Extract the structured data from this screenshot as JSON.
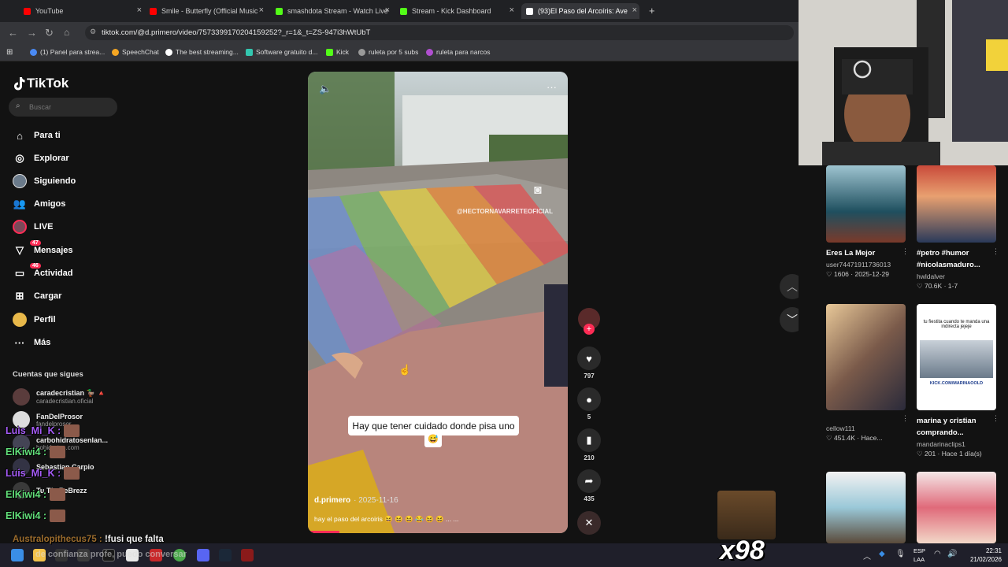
{
  "browser": {
    "tabs": [
      {
        "title": "YouTube",
        "color": "#ff0000"
      },
      {
        "title": "Smile - Butterfly (Official Music",
        "color": "#ff0000"
      },
      {
        "title": "smashdota Stream - Watch Live",
        "color": "#53fc18"
      },
      {
        "title": "Stream - Kick Dashboard",
        "color": "#53fc18"
      },
      {
        "title": "(93)El Paso del Arcoíris: Ave",
        "color": "#ffffff"
      }
    ],
    "url": "tiktok.com/@d.primero/video/7573399170204159252?_r=1&_t=ZS-947i3hWtUbT",
    "bookmarks": [
      "(1) Panel para strea...",
      "SpeechChat",
      "The best streaming...",
      "Software gratuito d...",
      "Kick",
      "ruleta por 5 subs",
      "ruleta para narcos"
    ]
  },
  "tiktok": {
    "logo": "TikTok",
    "search_placeholder": "Buscar",
    "nav": [
      {
        "label": "Para ti",
        "icon": "home-icon"
      },
      {
        "label": "Explorar",
        "icon": "compass-icon"
      },
      {
        "label": "Siguiendo",
        "icon": "following-icon"
      },
      {
        "label": "Amigos",
        "icon": "friends-icon"
      },
      {
        "label": "LIVE",
        "icon": "live-icon"
      },
      {
        "label": "Mensajes",
        "icon": "messages-icon",
        "badge": "47"
      },
      {
        "label": "Actividad",
        "icon": "activity-icon",
        "badge": "46"
      },
      {
        "label": "Cargar",
        "icon": "upload-icon"
      },
      {
        "label": "Perfil",
        "icon": "profile-icon"
      },
      {
        "label": "Más",
        "icon": "more-icon"
      }
    ],
    "following_header": "Cuentas que sigues",
    "following": [
      {
        "name": "caradecristian 🦆 🔺",
        "handle": "caradecristian.oficial"
      },
      {
        "name": "FanDelProsor",
        "handle": "fandelprosor"
      },
      {
        "name": "carbohidratosenlan...",
        "handle": "bohidratos.com"
      },
      {
        "name": "Sebastian Carpio",
        "handle": ""
      },
      {
        "name": "Tu Tío ReBrezz",
        "handle": ""
      }
    ],
    "video": {
      "author": "d.primero",
      "date": "· 2025-11-16",
      "description": "hay el paso del arcoiris 😆 😆 😆 😂 😆 😆 ... ...",
      "caption": "Hay que tener cuidado donde pisa uno",
      "caption_emoji": "😅",
      "watermark": "@HECTORNAVARRETEOFICIAL"
    },
    "actions": {
      "likes": "797",
      "comments": "5",
      "saves": "210",
      "shares": "435"
    },
    "recommended": [
      {
        "title": "Eres La Mejor",
        "user": "user74471911736013",
        "likes": "1606",
        "date": "2025-12-29"
      },
      {
        "title": "#petro #humor #nicolasmaduro...",
        "user": "hwldalver",
        "likes": "70.6K",
        "date": "1-7"
      },
      {
        "title": "",
        "user": "cellow111",
        "likes": "451.4K",
        "date": "Hace..."
      },
      {
        "title": "marina y cristian comprando...",
        "user": "mandarinaclips1",
        "likes": "201",
        "date": "Hace 1 día(s)"
      }
    ],
    "thumb_text": "tu fiestita cuando te manda una indirecta jejeje",
    "thumb_url_text": "KICK.COM/MARINAOOLD"
  },
  "chat": [
    {
      "user": "Luis_Mi_K :",
      "color": "#a55bf7"
    },
    {
      "user": "ElKiwi4 :",
      "color": "#62e07a"
    },
    {
      "user": "Luis_Mi_K :",
      "color": "#a55bf7"
    },
    {
      "user": "ElKiwi4 :",
      "color": "#62e07a"
    },
    {
      "user": "ElKiwi4 :",
      "color": "#62e07a"
    }
  ],
  "chat_long": {
    "user": "Australopithecus75 :",
    "message": "!fusi que falta"
  },
  "chat_under": "de confianza profe, puedo conversar",
  "overlay_counter": "x98",
  "taskbar": {
    "lang": "ESP",
    "lang2": "LAA",
    "time": "22:31",
    "date": "21/02/2026"
  }
}
